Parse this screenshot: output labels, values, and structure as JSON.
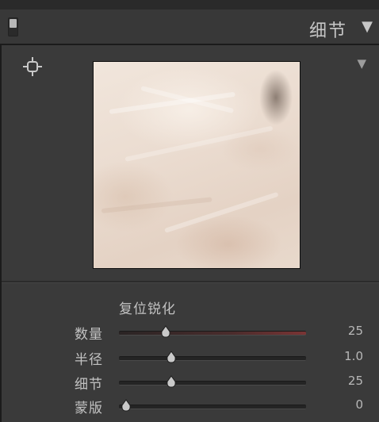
{
  "panel": {
    "title": "细节",
    "collapse_glyph": "▼",
    "switch_icon": "panel-toggle-switch"
  },
  "preview": {
    "target_icon": "crosshair-target-icon",
    "expand_glyph": "▼"
  },
  "sharpening": {
    "section_title": "复位锐化",
    "sliders": [
      {
        "label": "数量",
        "value": "25",
        "position": 0.25,
        "track": "red"
      },
      {
        "label": "半径",
        "value": "1.0",
        "position": 0.28,
        "track": "gray"
      },
      {
        "label": "细节",
        "value": "25",
        "position": 0.28,
        "track": "gray"
      },
      {
        "label": "蒙版",
        "value": "0",
        "position": 0.04,
        "track": "gray"
      }
    ]
  },
  "colors": {
    "panel_bg": "#3a3a3a",
    "header_bg": "#383838",
    "text": "#c2c2c2",
    "amount_track_accent": "#7a3434"
  }
}
